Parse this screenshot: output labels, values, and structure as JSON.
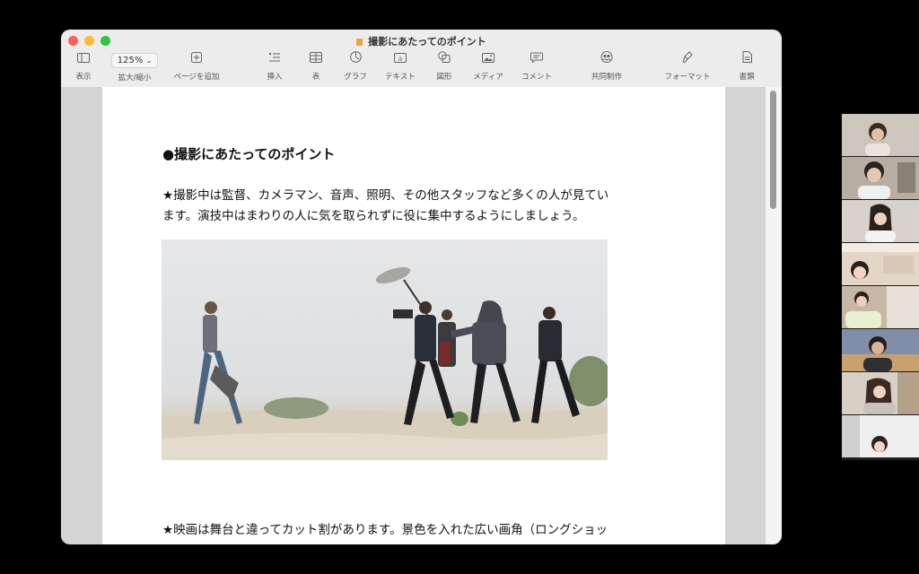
{
  "window": {
    "title": "撮影にあたってのポイント"
  },
  "toolbar": {
    "view_label": "表示",
    "zoom_value": "125%",
    "zoom_label": "拡大/縮小",
    "add_page_label": "ページを追加",
    "insert_label": "挿入",
    "table_label": "表",
    "chart_label": "グラフ",
    "text_label": "テキスト",
    "shape_label": "図形",
    "media_label": "メディア",
    "comment_label": "コメント",
    "collaborate_label": "共同制作",
    "format_label": "フォーマット",
    "document_label": "書類"
  },
  "document": {
    "heading": "●撮影にあたってのポイント",
    "paragraph1_line1": "★撮影中は監督、カメラマン、音声、照明、その他スタッフなど多くの人が見てい",
    "paragraph1_line2": "ます。演技中はまわりの人に気を取られずに役に集中するようにしましょう。",
    "paragraph2_partial": "★映画は舞台と違ってカット割があります。景色を入れた広い画角（ロングショッ"
  },
  "icons": {
    "view": "sidebar-icon",
    "add_page": "plus-square-icon",
    "insert": "list-icon",
    "table": "table-icon",
    "chart": "clock-chart-icon",
    "text": "textbox-icon",
    "shape": "shapes-icon",
    "media": "image-icon",
    "comment": "speech-bubble-icon",
    "collaborate": "people-icon",
    "format": "paintbrush-icon",
    "document": "document-icon"
  },
  "colors": {
    "close": "#ff5f57",
    "minimize": "#febc2e",
    "maximize": "#28c840"
  }
}
